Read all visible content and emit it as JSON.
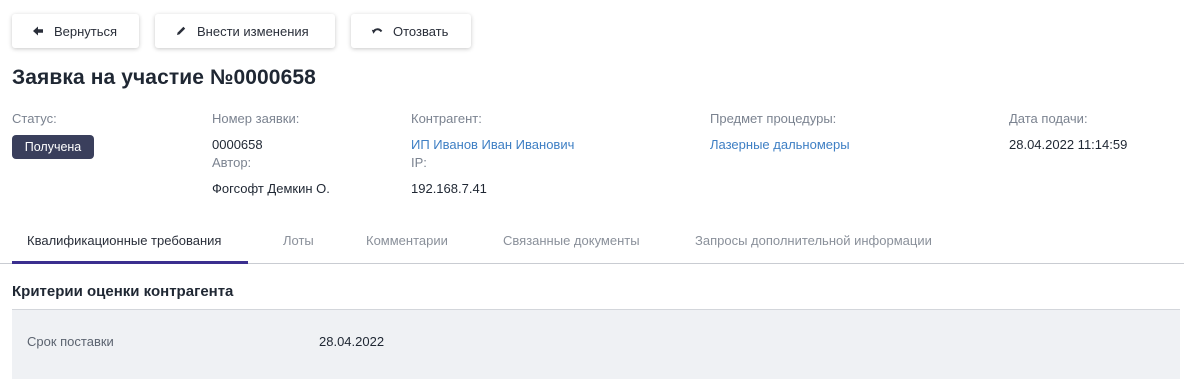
{
  "toolbar": {
    "back_label": "Вернуться",
    "edit_label": "Внести изменения",
    "revoke_label": "Отозвать"
  },
  "page_title": "Заявка на участие №0000658",
  "details": {
    "status_label": "Статус:",
    "status_value": "Получена",
    "number_label": "Номер заявки:",
    "number_value": "0000658",
    "author_label": "Автор:",
    "author_value": "Фогсофт Демкин О.",
    "counterparty_label": "Контрагент:",
    "counterparty_value": "ИП Иванов Иван Иванович",
    "ip_label": "IP:",
    "ip_value": "192.168.7.41",
    "subject_label": "Предмет процедуры:",
    "subject_value": "Лазерные дальномеры",
    "date_label": "Дата подачи:",
    "date_value": "28.04.2022 11:14:59"
  },
  "tabs": [
    {
      "label": "Квалификационные требования"
    },
    {
      "label": "Лоты"
    },
    {
      "label": "Комментарии"
    },
    {
      "label": "Связанные документы"
    },
    {
      "label": "Запросы дополнительной информации"
    }
  ],
  "criteria": {
    "title": "Критерии оценки контрагента",
    "rows": [
      {
        "label": "Срок поставки",
        "value": "28.04.2022"
      }
    ]
  },
  "colors": {
    "badge": "#3a3f5c",
    "link": "#3e7fc4",
    "tab_underline": "#3b2f8f"
  }
}
